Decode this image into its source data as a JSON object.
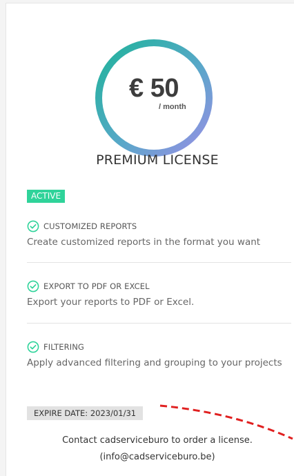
{
  "license": {
    "price": "€ 50",
    "period": "/ month",
    "title": "PREMIUM LICENSE",
    "status": "ACTIVE"
  },
  "features": [
    {
      "title": "CUSTOMIZED REPORTS",
      "description": "Create customized reports in the format you want"
    },
    {
      "title": "EXPORT TO PDF OR EXCEL",
      "description": "Export your reports to PDF or Excel."
    },
    {
      "title": "FILTERING",
      "description": "Apply advanced filtering and grouping to your projects"
    }
  ],
  "expire": {
    "label": "EXPIRE DATE: 2023/01/31"
  },
  "contact": {
    "line1": "Contact cadserviceburo to order a license.",
    "line2": "(info@cadserviceburo.be)"
  },
  "colors": {
    "ring_start": "#2bb89a",
    "ring_end": "#8a8fe0",
    "active_badge": "#2fd39a",
    "check_icon": "#2fd39a",
    "annotation": "#e02020"
  },
  "icons": {
    "feature": "check-circle-icon"
  }
}
